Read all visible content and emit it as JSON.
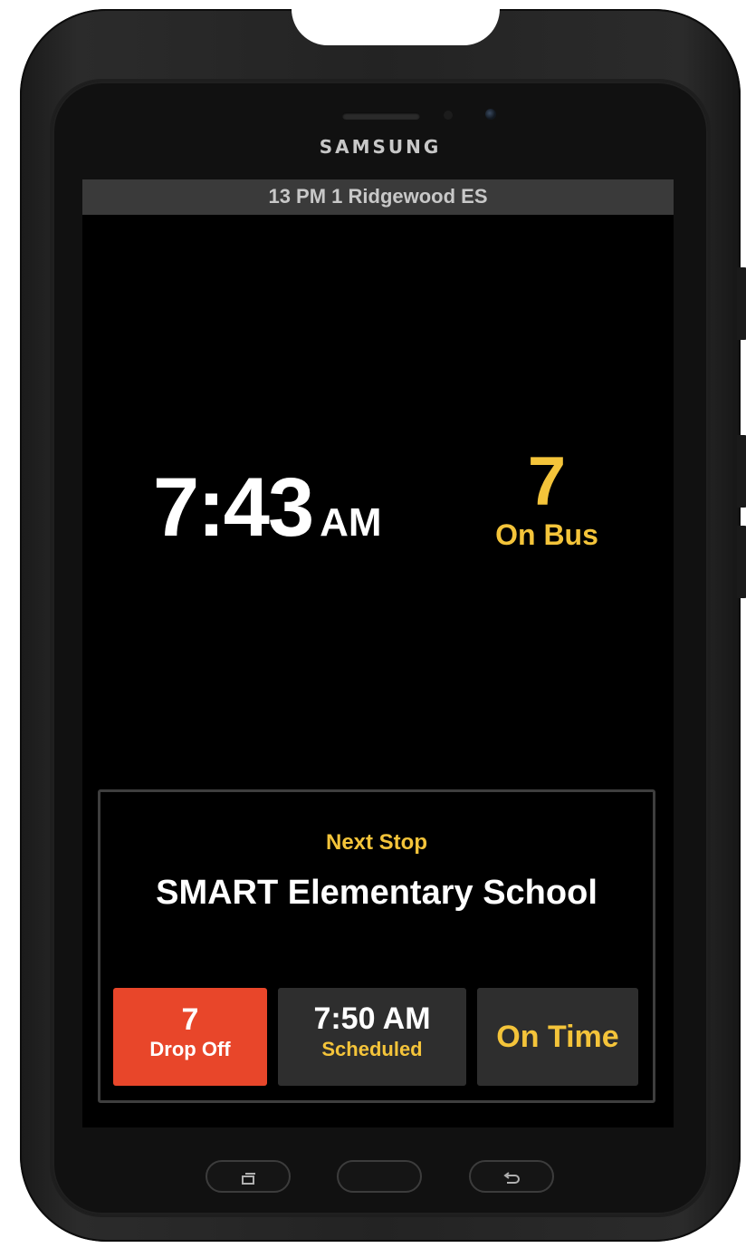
{
  "device": {
    "brand": "SAMSUNG"
  },
  "header": {
    "route_title": "13 PM 1 Ridgewood ES"
  },
  "clock": {
    "time": "7:43",
    "ampm": "AM"
  },
  "on_bus": {
    "count": "7",
    "label": "On Bus"
  },
  "next_stop": {
    "label": "Next Stop",
    "name": "SMART Elementary School",
    "drop_off": {
      "count": "7",
      "label": "Drop Off"
    },
    "scheduled": {
      "time": "7:50 AM",
      "label": "Scheduled"
    },
    "status": "On Time"
  },
  "nav_buttons": {
    "recent_icon": "recent-apps-icon",
    "home_icon": "home-icon",
    "back_icon": "back-icon"
  },
  "colors": {
    "accent_yellow": "#f4c43a",
    "drop_off_red": "#e8462a",
    "tile_gray": "#2e2e2e",
    "header_gray": "#3a3a3a"
  }
}
